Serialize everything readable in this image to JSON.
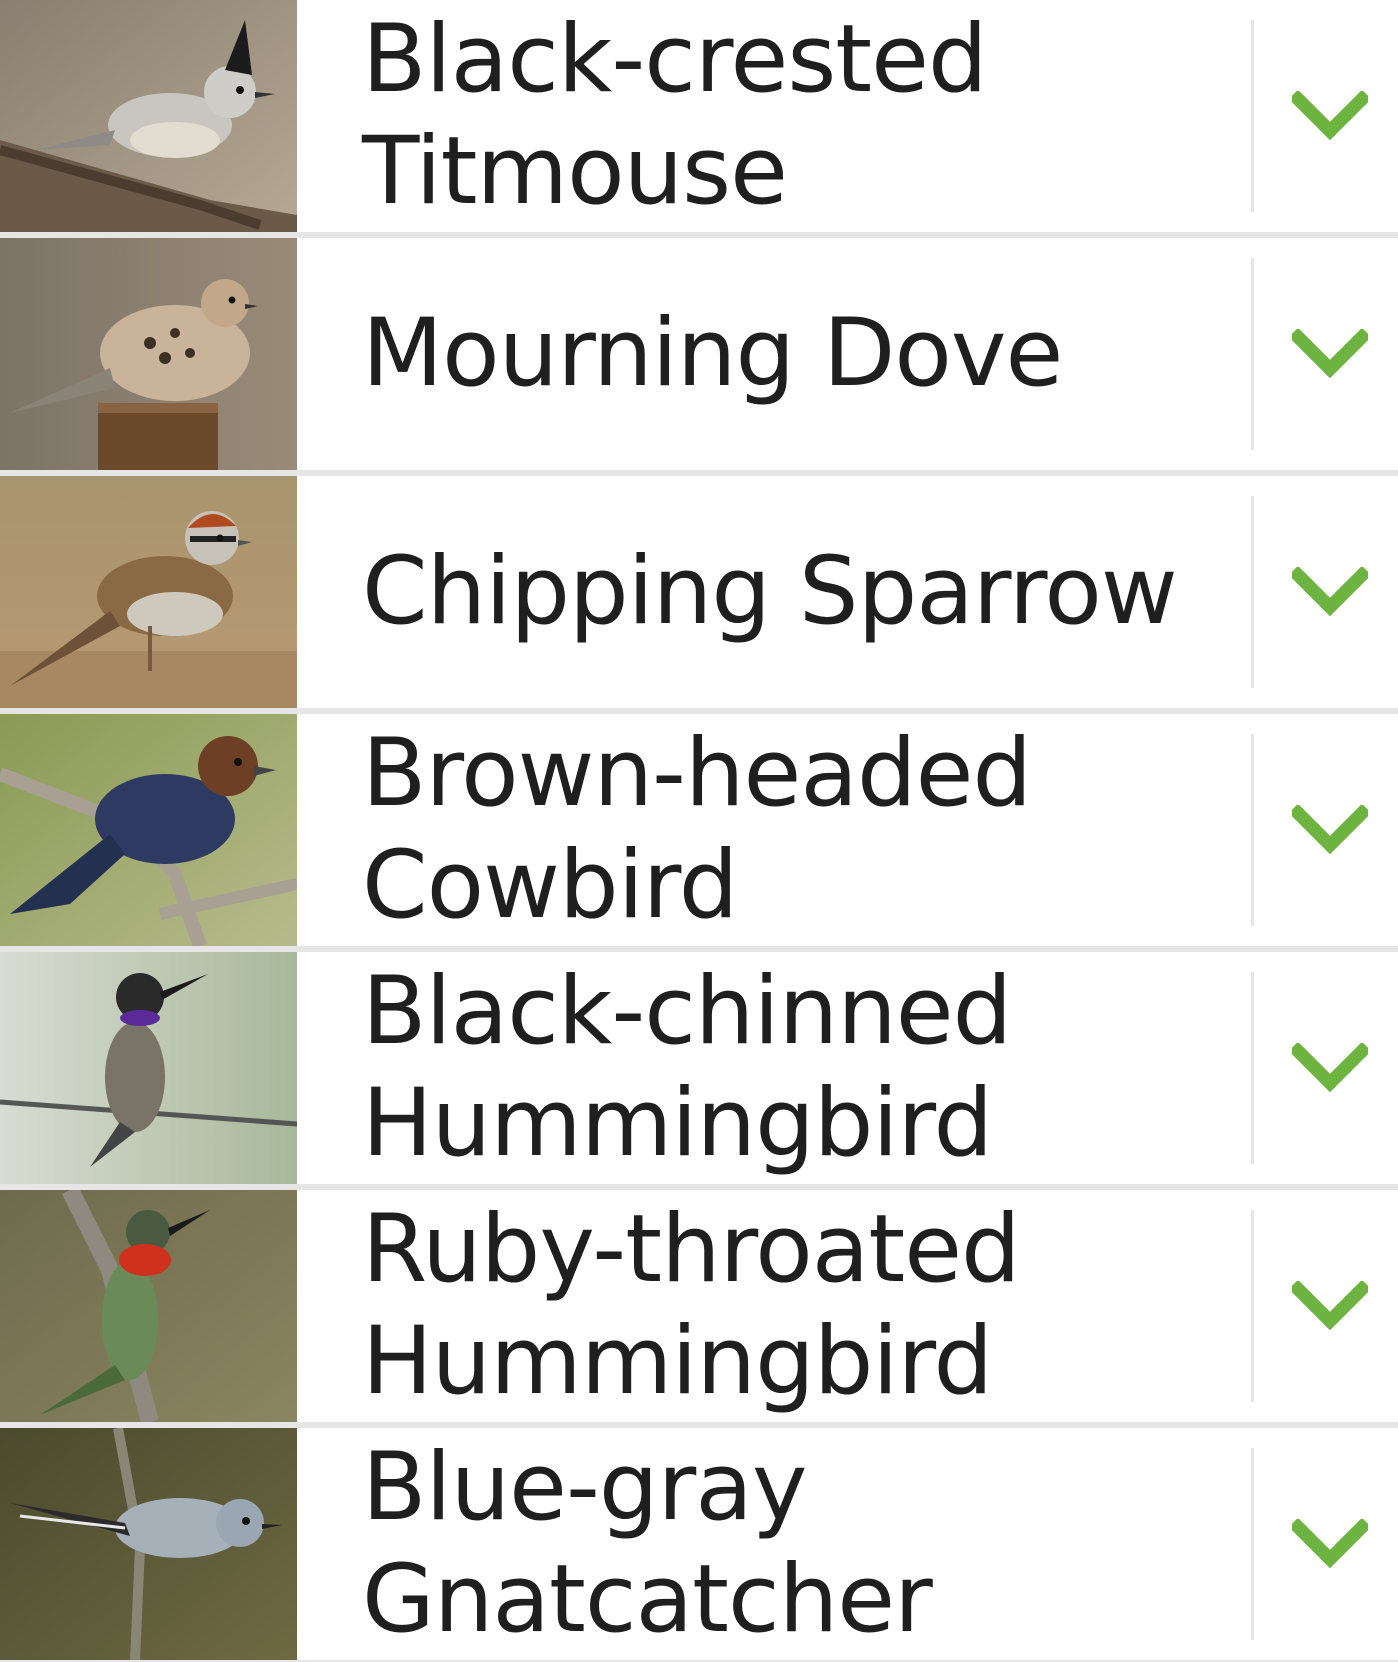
{
  "colors": {
    "chevron": "#6db33f",
    "divider": "#e6e6e6",
    "text": "#1f1f1f"
  },
  "birds": [
    {
      "name": "Black-crested Titmouse",
      "photo": "black-crested-titmouse-photo",
      "icon": "chevron-down-icon"
    },
    {
      "name": "Mourning Dove",
      "photo": "mourning-dove-photo",
      "icon": "chevron-down-icon"
    },
    {
      "name": "Chipping Sparrow",
      "photo": "chipping-sparrow-photo",
      "icon": "chevron-down-icon"
    },
    {
      "name": "Brown-headed Cowbird",
      "photo": "brown-headed-cowbird-photo",
      "icon": "chevron-down-icon"
    },
    {
      "name": "Black-chinned Hummingbird",
      "photo": "black-chinned-hummingbird-photo",
      "icon": "chevron-down-icon"
    },
    {
      "name": "Ruby-throated Hummingbird",
      "photo": "ruby-throated-hummingbird-photo",
      "icon": "chevron-down-icon"
    },
    {
      "name": "Blue-gray Gnatcatcher",
      "photo": "blue-gray-gnatcatcher-photo",
      "icon": "chevron-down-icon"
    }
  ]
}
